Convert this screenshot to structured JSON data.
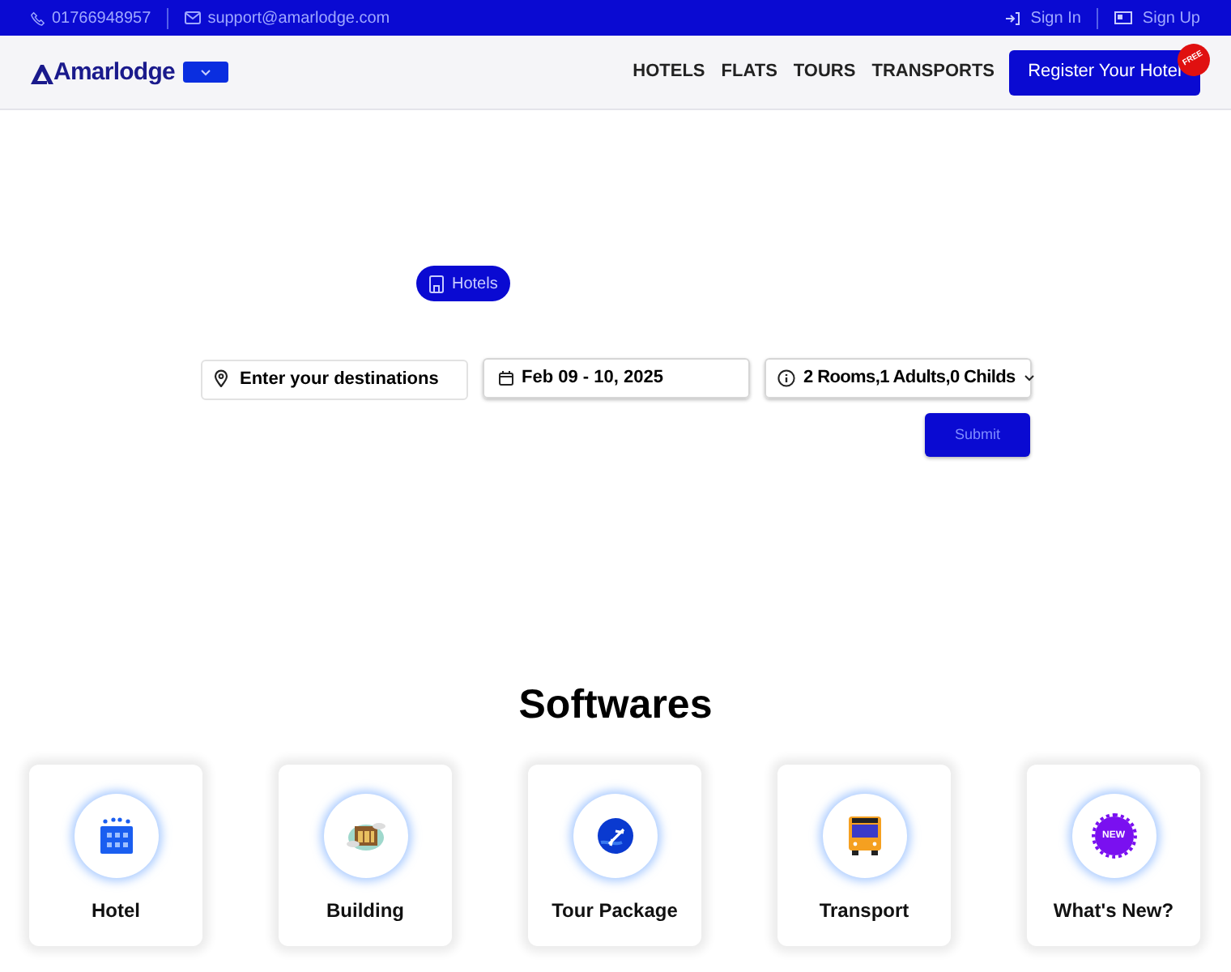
{
  "top_bar": {
    "phone": "01766948957",
    "email": "support@amarlodge.com",
    "sign_in": "Sign In",
    "sign_up": "Sign Up"
  },
  "header": {
    "logo": "Amarlodge",
    "nav": [
      "HOTELS",
      "FLATS",
      "TOURS",
      "TRANSPORTS"
    ],
    "register_button": "Register Your Hotel",
    "register_badge": "FREE"
  },
  "search": {
    "tabs": [
      {
        "label": "Hotels",
        "selected": true
      }
    ],
    "destination": {
      "placeholder": "Enter your destinations"
    },
    "dates": "Feb 09 - 10, 2025",
    "guests": "2 Rooms,1 Adults,0 Childs",
    "submit": "Submit"
  },
  "softwares": {
    "title": "Softwares",
    "items": [
      {
        "label": "Hotel",
        "kind": "hotel"
      },
      {
        "label": "Building",
        "kind": "building"
      },
      {
        "label": "Tour Package",
        "kind": "tour"
      },
      {
        "label": "Transport",
        "kind": "transport"
      },
      {
        "label": "What's New?",
        "kind": "new",
        "badge": "NEW"
      }
    ]
  }
}
